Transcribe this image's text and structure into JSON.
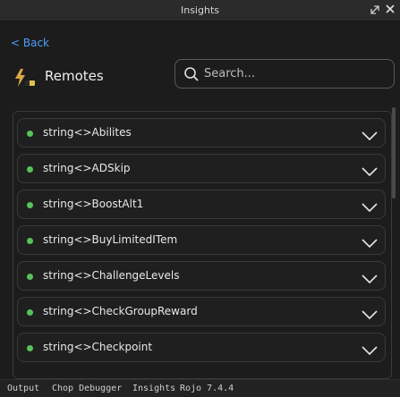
{
  "window": {
    "title": "Insights",
    "popout_icon": "popout-icon",
    "close_icon": "close-icon"
  },
  "nav": {
    "back_label": "< Back"
  },
  "header": {
    "title": "Remotes",
    "icon": "lightning-remote-icon"
  },
  "search": {
    "placeholder": "Search...",
    "icon": "search-icon"
  },
  "remotes": [
    {
      "name": "string<>Abilites",
      "status_color": "#57c25b"
    },
    {
      "name": "string<>ADSkip",
      "status_color": "#57c25b"
    },
    {
      "name": "string<>BoostAlt1",
      "status_color": "#57c25b"
    },
    {
      "name": "string<>BuyLimitedITem",
      "status_color": "#57c25b"
    },
    {
      "name": "string<>ChallengeLevels",
      "status_color": "#57c25b"
    },
    {
      "name": "string<>CheckGroupReward",
      "status_color": "#57c25b"
    },
    {
      "name": "string<>Checkpoint",
      "status_color": "#57c25b"
    }
  ],
  "statusbar": {
    "tabs": [
      "Output",
      "Chop Debugger",
      "Insights",
      "Rojo 7.4.4"
    ]
  },
  "colors": {
    "accent": "#4d9fff",
    "status_ok": "#57c25b",
    "background": "#1c1c1c"
  }
}
